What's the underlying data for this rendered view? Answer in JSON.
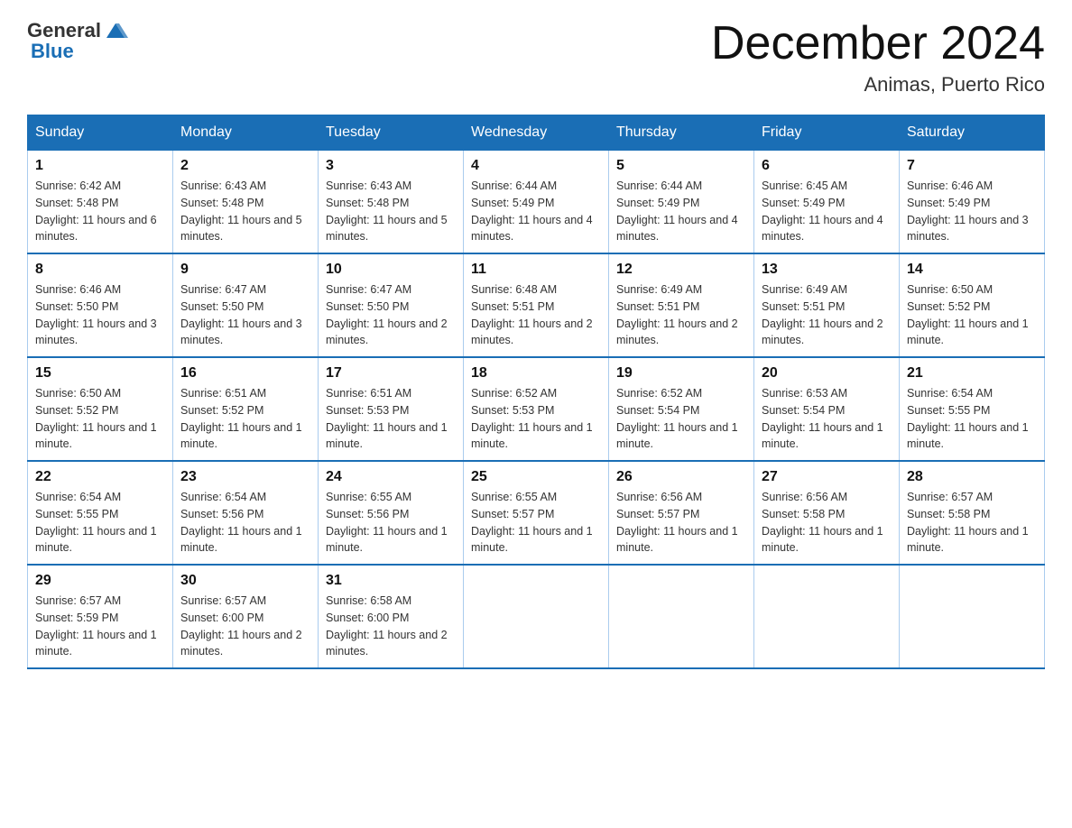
{
  "header": {
    "logo_general": "General",
    "logo_blue": "Blue",
    "month_title": "December 2024",
    "location": "Animas, Puerto Rico"
  },
  "columns": [
    "Sunday",
    "Monday",
    "Tuesday",
    "Wednesday",
    "Thursday",
    "Friday",
    "Saturday"
  ],
  "weeks": [
    [
      {
        "day": "1",
        "sunrise": "Sunrise: 6:42 AM",
        "sunset": "Sunset: 5:48 PM",
        "daylight": "Daylight: 11 hours and 6 minutes."
      },
      {
        "day": "2",
        "sunrise": "Sunrise: 6:43 AM",
        "sunset": "Sunset: 5:48 PM",
        "daylight": "Daylight: 11 hours and 5 minutes."
      },
      {
        "day": "3",
        "sunrise": "Sunrise: 6:43 AM",
        "sunset": "Sunset: 5:48 PM",
        "daylight": "Daylight: 11 hours and 5 minutes."
      },
      {
        "day": "4",
        "sunrise": "Sunrise: 6:44 AM",
        "sunset": "Sunset: 5:49 PM",
        "daylight": "Daylight: 11 hours and 4 minutes."
      },
      {
        "day": "5",
        "sunrise": "Sunrise: 6:44 AM",
        "sunset": "Sunset: 5:49 PM",
        "daylight": "Daylight: 11 hours and 4 minutes."
      },
      {
        "day": "6",
        "sunrise": "Sunrise: 6:45 AM",
        "sunset": "Sunset: 5:49 PM",
        "daylight": "Daylight: 11 hours and 4 minutes."
      },
      {
        "day": "7",
        "sunrise": "Sunrise: 6:46 AM",
        "sunset": "Sunset: 5:49 PM",
        "daylight": "Daylight: 11 hours and 3 minutes."
      }
    ],
    [
      {
        "day": "8",
        "sunrise": "Sunrise: 6:46 AM",
        "sunset": "Sunset: 5:50 PM",
        "daylight": "Daylight: 11 hours and 3 minutes."
      },
      {
        "day": "9",
        "sunrise": "Sunrise: 6:47 AM",
        "sunset": "Sunset: 5:50 PM",
        "daylight": "Daylight: 11 hours and 3 minutes."
      },
      {
        "day": "10",
        "sunrise": "Sunrise: 6:47 AM",
        "sunset": "Sunset: 5:50 PM",
        "daylight": "Daylight: 11 hours and 2 minutes."
      },
      {
        "day": "11",
        "sunrise": "Sunrise: 6:48 AM",
        "sunset": "Sunset: 5:51 PM",
        "daylight": "Daylight: 11 hours and 2 minutes."
      },
      {
        "day": "12",
        "sunrise": "Sunrise: 6:49 AM",
        "sunset": "Sunset: 5:51 PM",
        "daylight": "Daylight: 11 hours and 2 minutes."
      },
      {
        "day": "13",
        "sunrise": "Sunrise: 6:49 AM",
        "sunset": "Sunset: 5:51 PM",
        "daylight": "Daylight: 11 hours and 2 minutes."
      },
      {
        "day": "14",
        "sunrise": "Sunrise: 6:50 AM",
        "sunset": "Sunset: 5:52 PM",
        "daylight": "Daylight: 11 hours and 1 minute."
      }
    ],
    [
      {
        "day": "15",
        "sunrise": "Sunrise: 6:50 AM",
        "sunset": "Sunset: 5:52 PM",
        "daylight": "Daylight: 11 hours and 1 minute."
      },
      {
        "day": "16",
        "sunrise": "Sunrise: 6:51 AM",
        "sunset": "Sunset: 5:52 PM",
        "daylight": "Daylight: 11 hours and 1 minute."
      },
      {
        "day": "17",
        "sunrise": "Sunrise: 6:51 AM",
        "sunset": "Sunset: 5:53 PM",
        "daylight": "Daylight: 11 hours and 1 minute."
      },
      {
        "day": "18",
        "sunrise": "Sunrise: 6:52 AM",
        "sunset": "Sunset: 5:53 PM",
        "daylight": "Daylight: 11 hours and 1 minute."
      },
      {
        "day": "19",
        "sunrise": "Sunrise: 6:52 AM",
        "sunset": "Sunset: 5:54 PM",
        "daylight": "Daylight: 11 hours and 1 minute."
      },
      {
        "day": "20",
        "sunrise": "Sunrise: 6:53 AM",
        "sunset": "Sunset: 5:54 PM",
        "daylight": "Daylight: 11 hours and 1 minute."
      },
      {
        "day": "21",
        "sunrise": "Sunrise: 6:54 AM",
        "sunset": "Sunset: 5:55 PM",
        "daylight": "Daylight: 11 hours and 1 minute."
      }
    ],
    [
      {
        "day": "22",
        "sunrise": "Sunrise: 6:54 AM",
        "sunset": "Sunset: 5:55 PM",
        "daylight": "Daylight: 11 hours and 1 minute."
      },
      {
        "day": "23",
        "sunrise": "Sunrise: 6:54 AM",
        "sunset": "Sunset: 5:56 PM",
        "daylight": "Daylight: 11 hours and 1 minute."
      },
      {
        "day": "24",
        "sunrise": "Sunrise: 6:55 AM",
        "sunset": "Sunset: 5:56 PM",
        "daylight": "Daylight: 11 hours and 1 minute."
      },
      {
        "day": "25",
        "sunrise": "Sunrise: 6:55 AM",
        "sunset": "Sunset: 5:57 PM",
        "daylight": "Daylight: 11 hours and 1 minute."
      },
      {
        "day": "26",
        "sunrise": "Sunrise: 6:56 AM",
        "sunset": "Sunset: 5:57 PM",
        "daylight": "Daylight: 11 hours and 1 minute."
      },
      {
        "day": "27",
        "sunrise": "Sunrise: 6:56 AM",
        "sunset": "Sunset: 5:58 PM",
        "daylight": "Daylight: 11 hours and 1 minute."
      },
      {
        "day": "28",
        "sunrise": "Sunrise: 6:57 AM",
        "sunset": "Sunset: 5:58 PM",
        "daylight": "Daylight: 11 hours and 1 minute."
      }
    ],
    [
      {
        "day": "29",
        "sunrise": "Sunrise: 6:57 AM",
        "sunset": "Sunset: 5:59 PM",
        "daylight": "Daylight: 11 hours and 1 minute."
      },
      {
        "day": "30",
        "sunrise": "Sunrise: 6:57 AM",
        "sunset": "Sunset: 6:00 PM",
        "daylight": "Daylight: 11 hours and 2 minutes."
      },
      {
        "day": "31",
        "sunrise": "Sunrise: 6:58 AM",
        "sunset": "Sunset: 6:00 PM",
        "daylight": "Daylight: 11 hours and 2 minutes."
      },
      null,
      null,
      null,
      null
    ]
  ]
}
